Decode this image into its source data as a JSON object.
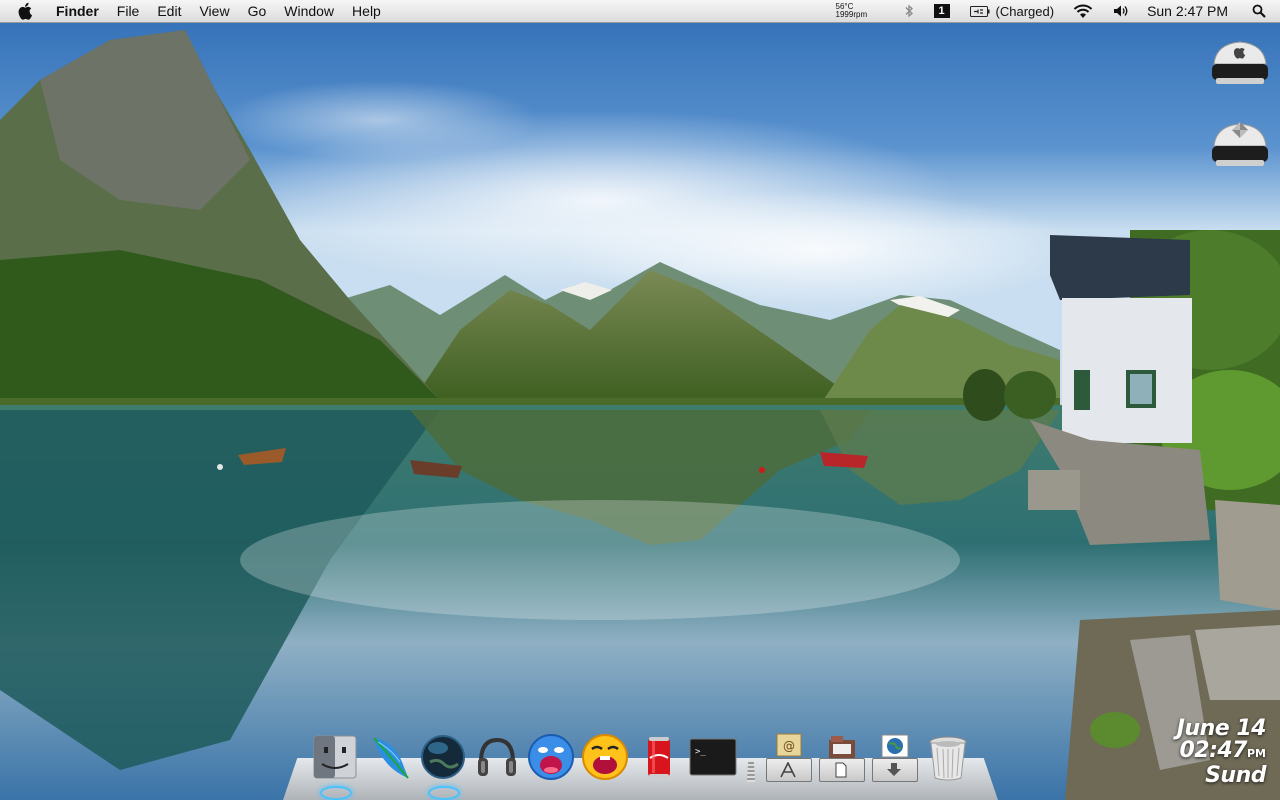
{
  "menubar": {
    "app_name": "Finder",
    "menus": [
      "File",
      "Edit",
      "View",
      "Go",
      "Window",
      "Help"
    ],
    "status": {
      "temperature": "56°C",
      "fan_speed": "1999rpm",
      "space_number": "1",
      "battery_text": "(Charged)",
      "datetime": "Sun 2:47 PM"
    }
  },
  "clock_widget": {
    "date": "June 14",
    "time": "02:47",
    "ampm": "PM",
    "day": "Sund"
  },
  "dock": {
    "apps": [
      "finder-icon",
      "feather-icon",
      "globe-icon",
      "headphones-icon",
      "blue-face-icon",
      "yellow-face-icon",
      "cola-can-icon",
      "terminal-icon"
    ],
    "stacks": [
      "applications-stack-icon",
      "documents-stack-icon",
      "downloads-stack-icon",
      "trash-icon"
    ],
    "terminal_prompt": ">_"
  },
  "colors": {
    "menubar_bg": "#e8e8e8",
    "running_indicator": "#49c2ff",
    "sky": "#3f7cc4",
    "water": "#2f6f70"
  }
}
